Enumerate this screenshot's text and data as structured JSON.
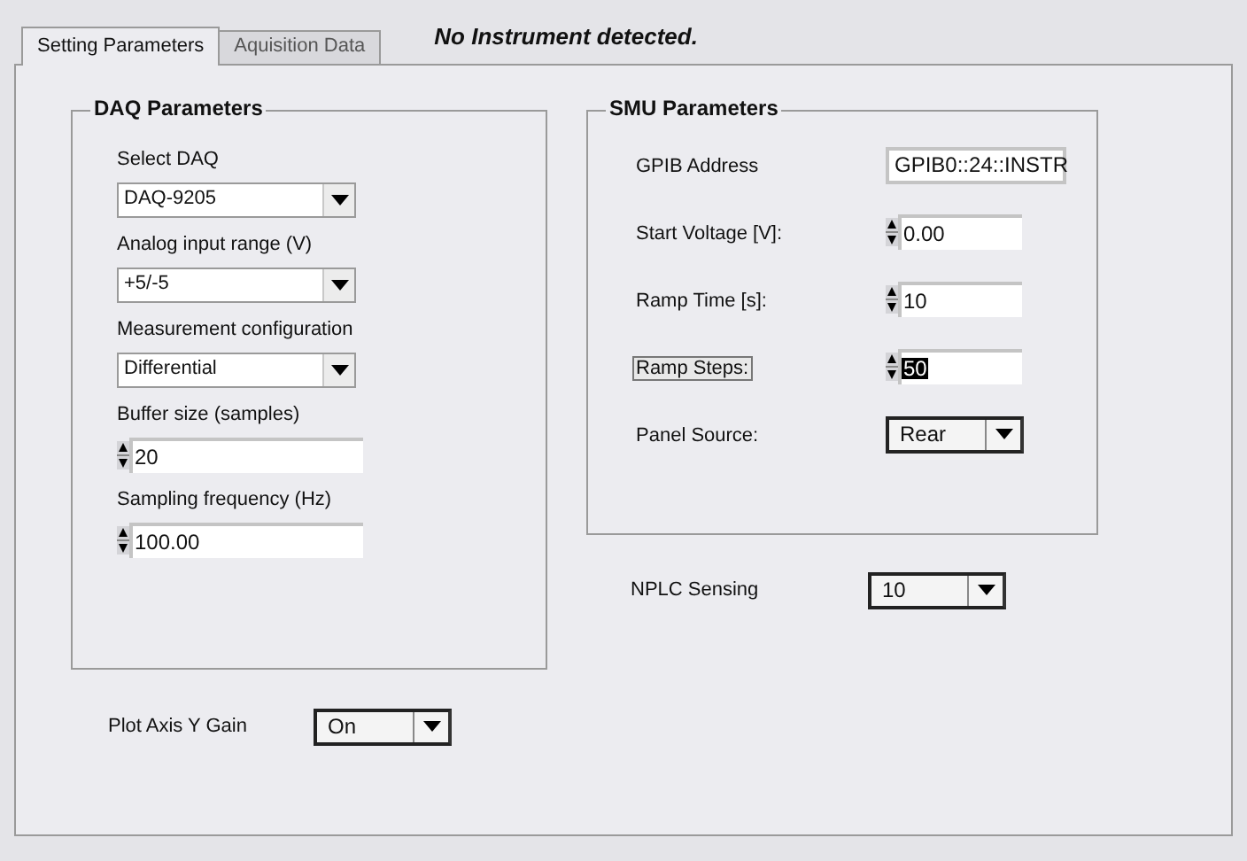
{
  "tabs": [
    {
      "label": "Setting Parameters",
      "selected": true
    },
    {
      "label": "Aquisition Data",
      "selected": false
    }
  ],
  "status_message": "No Instrument detected.",
  "daq_parameters": {
    "title": "DAQ Parameters",
    "controls": [
      {
        "kind": "dropdown",
        "label": "Select DAQ",
        "value": "DAQ-9205"
      },
      {
        "kind": "dropdown",
        "label": "Analog input range (V)",
        "value": "+5/-5"
      },
      {
        "kind": "dropdown",
        "label": "Measurement configuration",
        "value": "Differential"
      },
      {
        "kind": "numeric",
        "label": "Buffer size (samples)",
        "value": "20"
      },
      {
        "kind": "numeric",
        "label": "Sampling frequency (Hz)",
        "value": "100.00"
      }
    ]
  },
  "smu_parameters": {
    "title": "SMU Parameters",
    "controls": [
      {
        "kind": "text",
        "label": "GPIB Address",
        "value": "GPIB0::24::INSTR",
        "focused": false
      },
      {
        "kind": "numeric",
        "label": "Start Voltage [V]:",
        "value": "0.00",
        "focused": false
      },
      {
        "kind": "numeric",
        "label": "Ramp Time [s]:",
        "value": "10",
        "focused": false
      },
      {
        "kind": "numeric",
        "label": "Ramp Steps:",
        "value": "50",
        "focused": true
      },
      {
        "kind": "dropdown",
        "label": "Panel Source:",
        "value": "Rear",
        "focused": false
      }
    ]
  },
  "nplc_sensing": {
    "label": "NPLC Sensing",
    "value": "10"
  },
  "plot_axis_y_gain": {
    "label": "Plot Axis Y Gain",
    "value": "On"
  }
}
